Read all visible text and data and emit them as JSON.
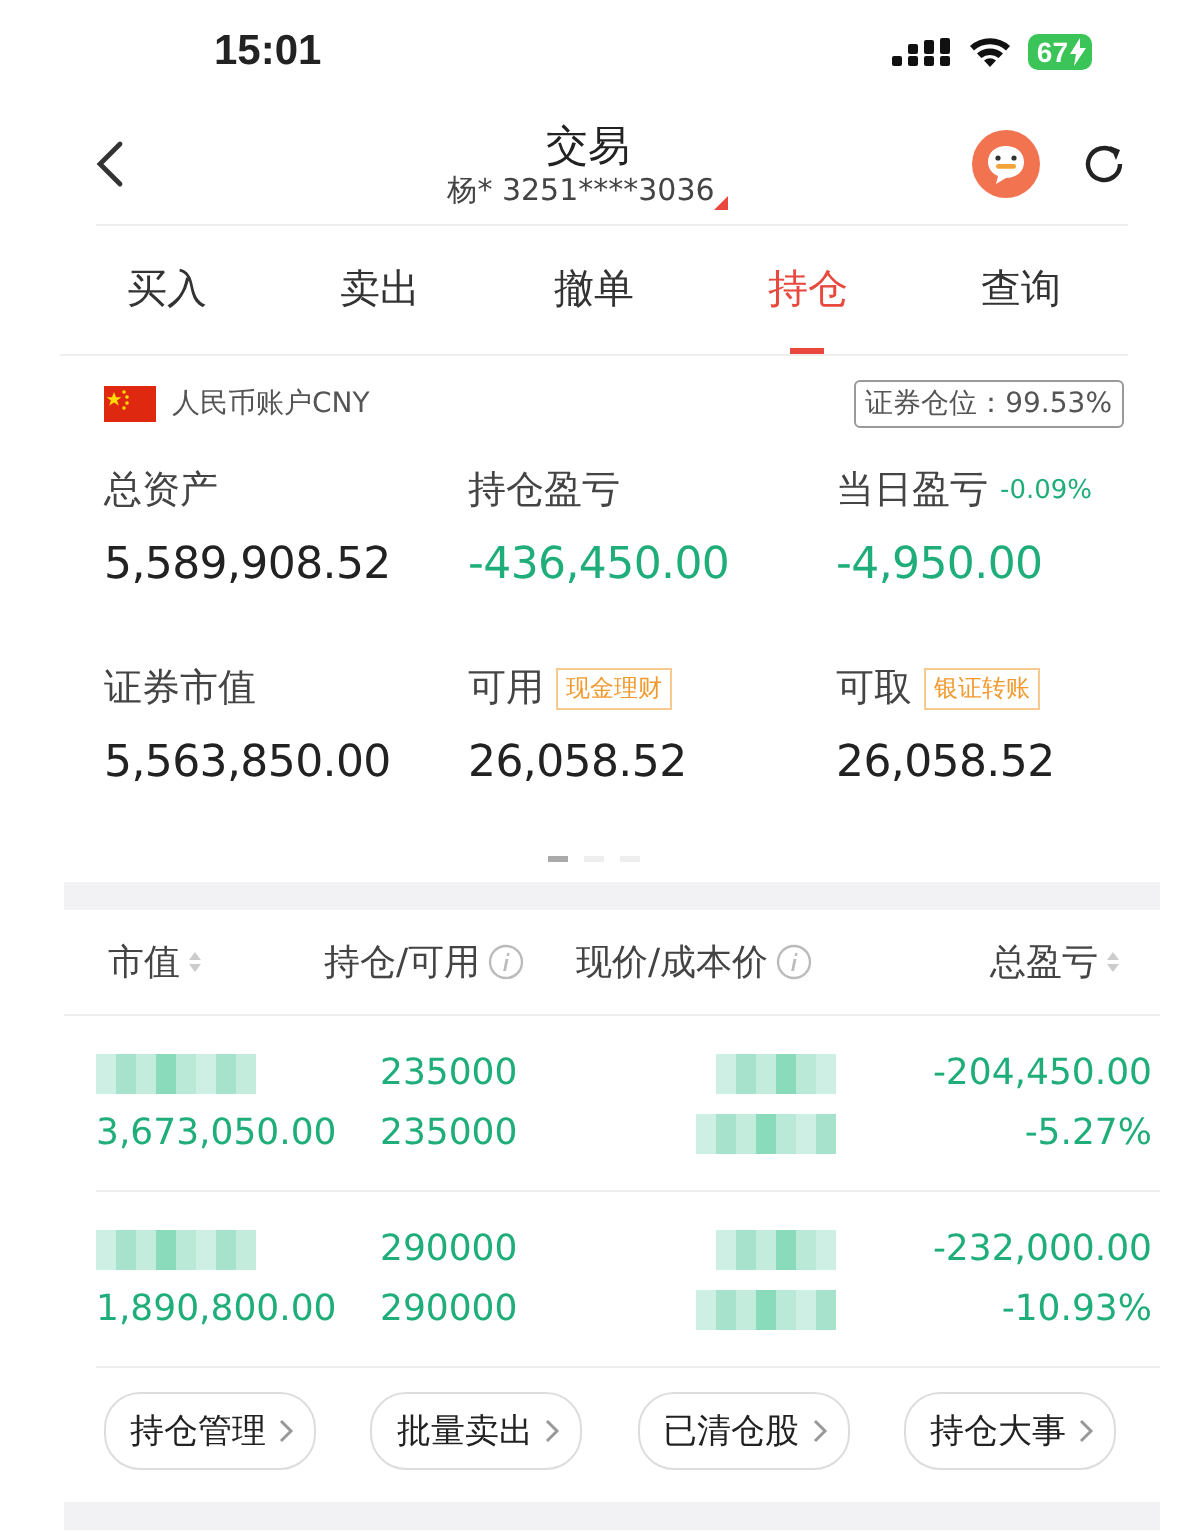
{
  "status_bar": {
    "time": "15:01",
    "battery": "67"
  },
  "header": {
    "title": "交易",
    "account": "杨* 3251****3036"
  },
  "tabs": [
    {
      "label": "买入",
      "selected": false
    },
    {
      "label": "卖出",
      "selected": false
    },
    {
      "label": "撤单",
      "selected": false
    },
    {
      "label": "持仓",
      "selected": true
    },
    {
      "label": "查询",
      "selected": false
    }
  ],
  "account": {
    "currency": "人民币账户CNY",
    "position_ratio": "证券仓位：99.53%",
    "metrics": [
      {
        "label": "总资产",
        "value": "5,589,908.52",
        "negative": false
      },
      {
        "label": "持仓盈亏",
        "value": "-436,450.00",
        "negative": true
      },
      {
        "label": "当日盈亏",
        "note": "-0.09%",
        "value": "-4,950.00",
        "negative": true
      },
      {
        "label": "证券市值",
        "value": "5,563,850.00",
        "negative": false
      },
      {
        "label": "可用",
        "tag": "现金理财",
        "value": "26,058.52",
        "negative": false
      },
      {
        "label": "可取",
        "tag": "银证转账",
        "value": "26,058.52",
        "negative": false
      }
    ],
    "pager": [
      {
        "selected": true
      },
      {
        "selected": false
      },
      {
        "selected": false
      }
    ]
  },
  "table": {
    "columns": [
      {
        "label": "市值",
        "kind": "sort"
      },
      {
        "label": "持仓/可用",
        "kind": "info"
      },
      {
        "label": "现价/成本价",
        "kind": "info"
      },
      {
        "label": "总盈亏",
        "kind": "sort"
      }
    ],
    "rows": [
      {
        "market_value": "3,673,050.00",
        "holding": "235000",
        "available": "235000",
        "profit": "-204,450.00",
        "profit_pct": "-5.27%"
      },
      {
        "market_value": "1,890,800.00",
        "holding": "290000",
        "available": "290000",
        "profit": "-232,000.00",
        "profit_pct": "-10.93%"
      }
    ]
  },
  "actions": [
    "持仓管理",
    "批量卖出",
    "已清仓股",
    "持仓大事"
  ]
}
